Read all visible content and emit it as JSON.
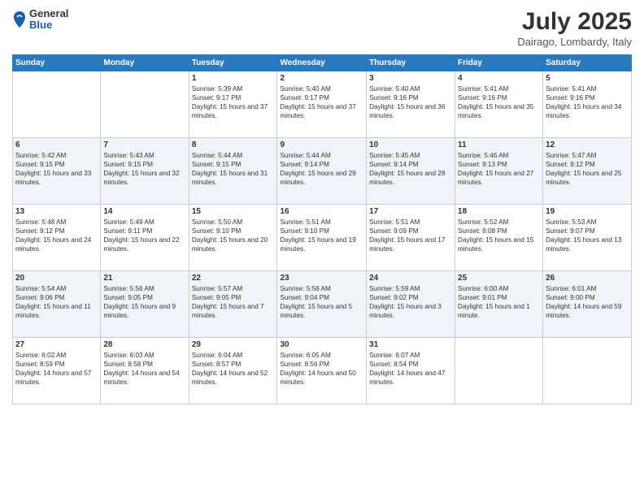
{
  "header": {
    "logo_general": "General",
    "logo_blue": "Blue",
    "month_title": "July 2025",
    "location": "Dairago, Lombardy, Italy"
  },
  "weekdays": [
    "Sunday",
    "Monday",
    "Tuesday",
    "Wednesday",
    "Thursday",
    "Friday",
    "Saturday"
  ],
  "weeks": [
    [
      {
        "day": "",
        "sunrise": "",
        "sunset": "",
        "daylight": ""
      },
      {
        "day": "",
        "sunrise": "",
        "sunset": "",
        "daylight": ""
      },
      {
        "day": "1",
        "sunrise": "Sunrise: 5:39 AM",
        "sunset": "Sunset: 9:17 PM",
        "daylight": "Daylight: 15 hours and 37 minutes."
      },
      {
        "day": "2",
        "sunrise": "Sunrise: 5:40 AM",
        "sunset": "Sunset: 9:17 PM",
        "daylight": "Daylight: 15 hours and 37 minutes."
      },
      {
        "day": "3",
        "sunrise": "Sunrise: 5:40 AM",
        "sunset": "Sunset: 9:16 PM",
        "daylight": "Daylight: 15 hours and 36 minutes."
      },
      {
        "day": "4",
        "sunrise": "Sunrise: 5:41 AM",
        "sunset": "Sunset: 9:16 PM",
        "daylight": "Daylight: 15 hours and 35 minutes."
      },
      {
        "day": "5",
        "sunrise": "Sunrise: 5:41 AM",
        "sunset": "Sunset: 9:16 PM",
        "daylight": "Daylight: 15 hours and 34 minutes."
      }
    ],
    [
      {
        "day": "6",
        "sunrise": "Sunrise: 5:42 AM",
        "sunset": "Sunset: 9:15 PM",
        "daylight": "Daylight: 15 hours and 33 minutes."
      },
      {
        "day": "7",
        "sunrise": "Sunrise: 5:43 AM",
        "sunset": "Sunset: 9:15 PM",
        "daylight": "Daylight: 15 hours and 32 minutes."
      },
      {
        "day": "8",
        "sunrise": "Sunrise: 5:44 AM",
        "sunset": "Sunset: 9:15 PM",
        "daylight": "Daylight: 15 hours and 31 minutes."
      },
      {
        "day": "9",
        "sunrise": "Sunrise: 5:44 AM",
        "sunset": "Sunset: 9:14 PM",
        "daylight": "Daylight: 15 hours and 29 minutes."
      },
      {
        "day": "10",
        "sunrise": "Sunrise: 5:45 AM",
        "sunset": "Sunset: 9:14 PM",
        "daylight": "Daylight: 15 hours and 28 minutes."
      },
      {
        "day": "11",
        "sunrise": "Sunrise: 5:46 AM",
        "sunset": "Sunset: 9:13 PM",
        "daylight": "Daylight: 15 hours and 27 minutes."
      },
      {
        "day": "12",
        "sunrise": "Sunrise: 5:47 AM",
        "sunset": "Sunset: 9:12 PM",
        "daylight": "Daylight: 15 hours and 25 minutes."
      }
    ],
    [
      {
        "day": "13",
        "sunrise": "Sunrise: 5:48 AM",
        "sunset": "Sunset: 9:12 PM",
        "daylight": "Daylight: 15 hours and 24 minutes."
      },
      {
        "day": "14",
        "sunrise": "Sunrise: 5:49 AM",
        "sunset": "Sunset: 9:11 PM",
        "daylight": "Daylight: 15 hours and 22 minutes."
      },
      {
        "day": "15",
        "sunrise": "Sunrise: 5:50 AM",
        "sunset": "Sunset: 9:10 PM",
        "daylight": "Daylight: 15 hours and 20 minutes."
      },
      {
        "day": "16",
        "sunrise": "Sunrise: 5:51 AM",
        "sunset": "Sunset: 9:10 PM",
        "daylight": "Daylight: 15 hours and 19 minutes."
      },
      {
        "day": "17",
        "sunrise": "Sunrise: 5:51 AM",
        "sunset": "Sunset: 9:09 PM",
        "daylight": "Daylight: 15 hours and 17 minutes."
      },
      {
        "day": "18",
        "sunrise": "Sunrise: 5:52 AM",
        "sunset": "Sunset: 9:08 PM",
        "daylight": "Daylight: 15 hours and 15 minutes."
      },
      {
        "day": "19",
        "sunrise": "Sunrise: 5:53 AM",
        "sunset": "Sunset: 9:07 PM",
        "daylight": "Daylight: 15 hours and 13 minutes."
      }
    ],
    [
      {
        "day": "20",
        "sunrise": "Sunrise: 5:54 AM",
        "sunset": "Sunset: 9:06 PM",
        "daylight": "Daylight: 15 hours and 11 minutes."
      },
      {
        "day": "21",
        "sunrise": "Sunrise: 5:56 AM",
        "sunset": "Sunset: 9:05 PM",
        "daylight": "Daylight: 15 hours and 9 minutes."
      },
      {
        "day": "22",
        "sunrise": "Sunrise: 5:57 AM",
        "sunset": "Sunset: 9:05 PM",
        "daylight": "Daylight: 15 hours and 7 minutes."
      },
      {
        "day": "23",
        "sunrise": "Sunrise: 5:58 AM",
        "sunset": "Sunset: 9:04 PM",
        "daylight": "Daylight: 15 hours and 5 minutes."
      },
      {
        "day": "24",
        "sunrise": "Sunrise: 5:59 AM",
        "sunset": "Sunset: 9:02 PM",
        "daylight": "Daylight: 15 hours and 3 minutes."
      },
      {
        "day": "25",
        "sunrise": "Sunrise: 6:00 AM",
        "sunset": "Sunset: 9:01 PM",
        "daylight": "Daylight: 15 hours and 1 minute."
      },
      {
        "day": "26",
        "sunrise": "Sunrise: 6:01 AM",
        "sunset": "Sunset: 9:00 PM",
        "daylight": "Daylight: 14 hours and 59 minutes."
      }
    ],
    [
      {
        "day": "27",
        "sunrise": "Sunrise: 6:02 AM",
        "sunset": "Sunset: 8:59 PM",
        "daylight": "Daylight: 14 hours and 57 minutes."
      },
      {
        "day": "28",
        "sunrise": "Sunrise: 6:03 AM",
        "sunset": "Sunset: 8:58 PM",
        "daylight": "Daylight: 14 hours and 54 minutes."
      },
      {
        "day": "29",
        "sunrise": "Sunrise: 6:04 AM",
        "sunset": "Sunset: 8:57 PM",
        "daylight": "Daylight: 14 hours and 52 minutes."
      },
      {
        "day": "30",
        "sunrise": "Sunrise: 6:05 AM",
        "sunset": "Sunset: 8:56 PM",
        "daylight": "Daylight: 14 hours and 50 minutes."
      },
      {
        "day": "31",
        "sunrise": "Sunrise: 6:07 AM",
        "sunset": "Sunset: 8:54 PM",
        "daylight": "Daylight: 14 hours and 47 minutes."
      },
      {
        "day": "",
        "sunrise": "",
        "sunset": "",
        "daylight": ""
      },
      {
        "day": "",
        "sunrise": "",
        "sunset": "",
        "daylight": ""
      }
    ]
  ]
}
